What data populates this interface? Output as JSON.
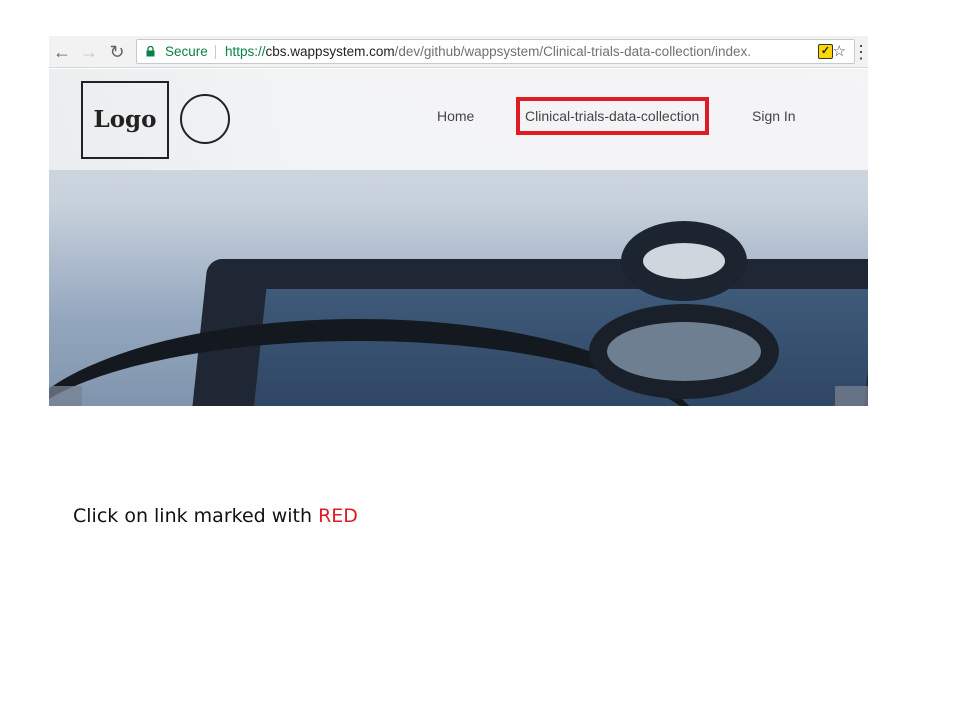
{
  "browser": {
    "back_icon": "arrow-left",
    "forward_icon": "arrow-right",
    "reload_icon": "reload",
    "secure_label": "Secure",
    "url_scheme": "https://",
    "url_host": "cbs.wappsystem.com",
    "url_path": "/dev/github/wappsystem/Clinical-trials-data-collection/index.",
    "colors": {
      "secure": "#0b8043"
    }
  },
  "site": {
    "logo_text": "Logo",
    "nav": {
      "home": "Home",
      "clinical": "Clinical-trials-data-collection",
      "signin": "Sign In"
    },
    "highlight_color": "#e01b24"
  },
  "instruction": {
    "text": "Click on link marked with ",
    "highlight": "RED"
  }
}
